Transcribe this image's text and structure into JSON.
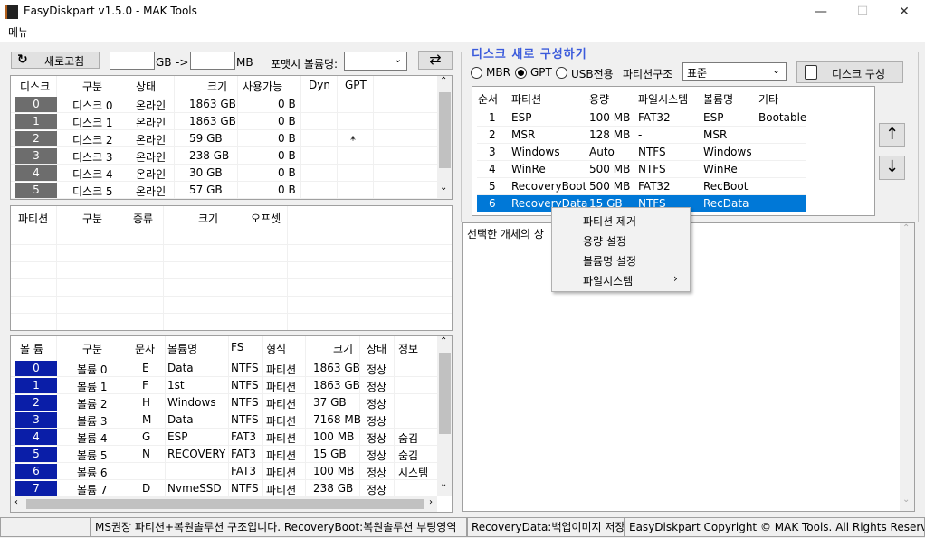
{
  "window": {
    "title": "EasyDiskpart v1.5.0 - MAK Tools",
    "minimize": "—",
    "maximize": "☐",
    "close": "✕"
  },
  "menu": {
    "label": "메뉴"
  },
  "toolbar": {
    "refresh_label": "새로고침",
    "gb_unit": "GB",
    "arrow": "->",
    "mb_unit": "MB",
    "volume_label_caption": "포맷시 볼륨명:",
    "swap_symbol": "⇄"
  },
  "disks": {
    "headers": [
      "디스크",
      "구분",
      "상태",
      "크기",
      "사용가능",
      "Dyn",
      "GPT"
    ],
    "rows": [
      {
        "num": "0",
        "name": "디스크 0",
        "status": "온라인",
        "size": "1863 GB",
        "free": "0 B",
        "dyn": "",
        "gpt": ""
      },
      {
        "num": "1",
        "name": "디스크 1",
        "status": "온라인",
        "size": "1863 GB",
        "free": "0 B",
        "dyn": "",
        "gpt": ""
      },
      {
        "num": "2",
        "name": "디스크 2",
        "status": "온라인",
        "size": "59 GB",
        "free": "0 B",
        "dyn": "",
        "gpt": "*"
      },
      {
        "num": "3",
        "name": "디스크 3",
        "status": "온라인",
        "size": "238 GB",
        "free": "0 B",
        "dyn": "",
        "gpt": ""
      },
      {
        "num": "4",
        "name": "디스크 4",
        "status": "온라인",
        "size": "30 GB",
        "free": "0 B",
        "dyn": "",
        "gpt": ""
      },
      {
        "num": "5",
        "name": "디스크 5",
        "status": "온라인",
        "size": "57 GB",
        "free": "0 B",
        "dyn": "",
        "gpt": ""
      }
    ]
  },
  "partitions": {
    "headers": [
      "파티션",
      "구분",
      "종류",
      "크기",
      "오프셋"
    ]
  },
  "volumes": {
    "headers": [
      "볼 륨",
      "구분",
      "문자",
      "볼륨명",
      "FS",
      "형식",
      "크기",
      "상태",
      "정보"
    ],
    "rows": [
      {
        "num": "0",
        "name": "볼륨 0",
        "letter": "E",
        "label": "Data",
        "fs": "NTFS",
        "type": "파티션",
        "size": "1863 GB",
        "state": "정상",
        "info": ""
      },
      {
        "num": "1",
        "name": "볼륨 1",
        "letter": "F",
        "label": "1st",
        "fs": "NTFS",
        "type": "파티션",
        "size": "1863 GB",
        "state": "정상",
        "info": ""
      },
      {
        "num": "2",
        "name": "볼륨 2",
        "letter": "H",
        "label": "Windows",
        "fs": "NTFS",
        "type": "파티션",
        "size": "37 GB",
        "state": "정상",
        "info": ""
      },
      {
        "num": "3",
        "name": "볼륨 3",
        "letter": "M",
        "label": "Data",
        "fs": "NTFS",
        "type": "파티션",
        "size": "7168 MB",
        "state": "정상",
        "info": ""
      },
      {
        "num": "4",
        "name": "볼륨 4",
        "letter": "G",
        "label": "ESP",
        "fs": "FAT3",
        "type": "파티션",
        "size": "100 MB",
        "state": "정상",
        "info": "숨김"
      },
      {
        "num": "5",
        "name": "볼륨 5",
        "letter": "N",
        "label": "RECOVERY",
        "fs": "FAT3",
        "type": "파티션",
        "size": "15 GB",
        "state": "정상",
        "info": "숨김"
      },
      {
        "num": "6",
        "name": "볼륨 6",
        "letter": "",
        "label": "",
        "fs": "FAT3",
        "type": "파티션",
        "size": "100 MB",
        "state": "정상",
        "info": "시스템"
      },
      {
        "num": "7",
        "name": "볼륨 7",
        "letter": "D",
        "label": "NvmeSSD",
        "fs": "NTFS",
        "type": "파티션",
        "size": "238 GB",
        "state": "정상",
        "info": ""
      }
    ]
  },
  "reconfig": {
    "group_title": "디스크 새로 구성하기",
    "mbr": "MBR",
    "gpt": "GPT",
    "usb": "USB전용",
    "selected_scheme": "GPT",
    "structure_caption": "파티션구조",
    "structure_value": "표준",
    "build_button": "디스크 구성",
    "headers": [
      "순서",
      "파티션",
      "용량",
      "파일시스템",
      "볼륨명",
      "기타"
    ],
    "rows": [
      {
        "num": "1",
        "part": "ESP",
        "size": "100 MB",
        "fs": "FAT32",
        "label": "ESP",
        "etc": "Bootable"
      },
      {
        "num": "2",
        "part": "MSR",
        "size": "128 MB",
        "fs": "-",
        "label": "MSR",
        "etc": ""
      },
      {
        "num": "3",
        "part": "Windows",
        "size": "Auto",
        "fs": "NTFS",
        "label": "Windows",
        "etc": ""
      },
      {
        "num": "4",
        "part": "WinRe",
        "size": "500 MB",
        "fs": "NTFS",
        "label": "WinRe",
        "etc": ""
      },
      {
        "num": "5",
        "part": "RecoveryBoot",
        "size": "500 MB",
        "fs": "FAT32",
        "label": "RecBoot",
        "etc": ""
      },
      {
        "num": "6",
        "part": "RecoveryData",
        "size": "15 GB",
        "fs": "NTFS",
        "label": "RecData",
        "etc": ""
      }
    ],
    "selected_row": "6",
    "up_arrow": "↑",
    "down_arrow": "↓",
    "description": "선택한 개체의 상"
  },
  "context_menu": {
    "items": [
      "파티션 제거",
      "용량 설정",
      "볼륨명 설정",
      "파일시스템"
    ],
    "submenu_arrow": "›"
  },
  "status_bar": {
    "left": "",
    "middle": "MS권장 파티션+복원솔루션 구조입니다. RecoveryBoot:복원솔루션 부팅영역",
    "middle2": "RecoveryData:백업이미지 저장",
    "right": "EasyDiskpart Copyright © MAK Tools. All Rights Reserved."
  },
  "colors": {
    "accent_blue": "#0078d7",
    "volume_num_bg": "#0a1ea8",
    "disk_num_bg": "#6d6d6d",
    "group_title": "#3b5bdb"
  }
}
